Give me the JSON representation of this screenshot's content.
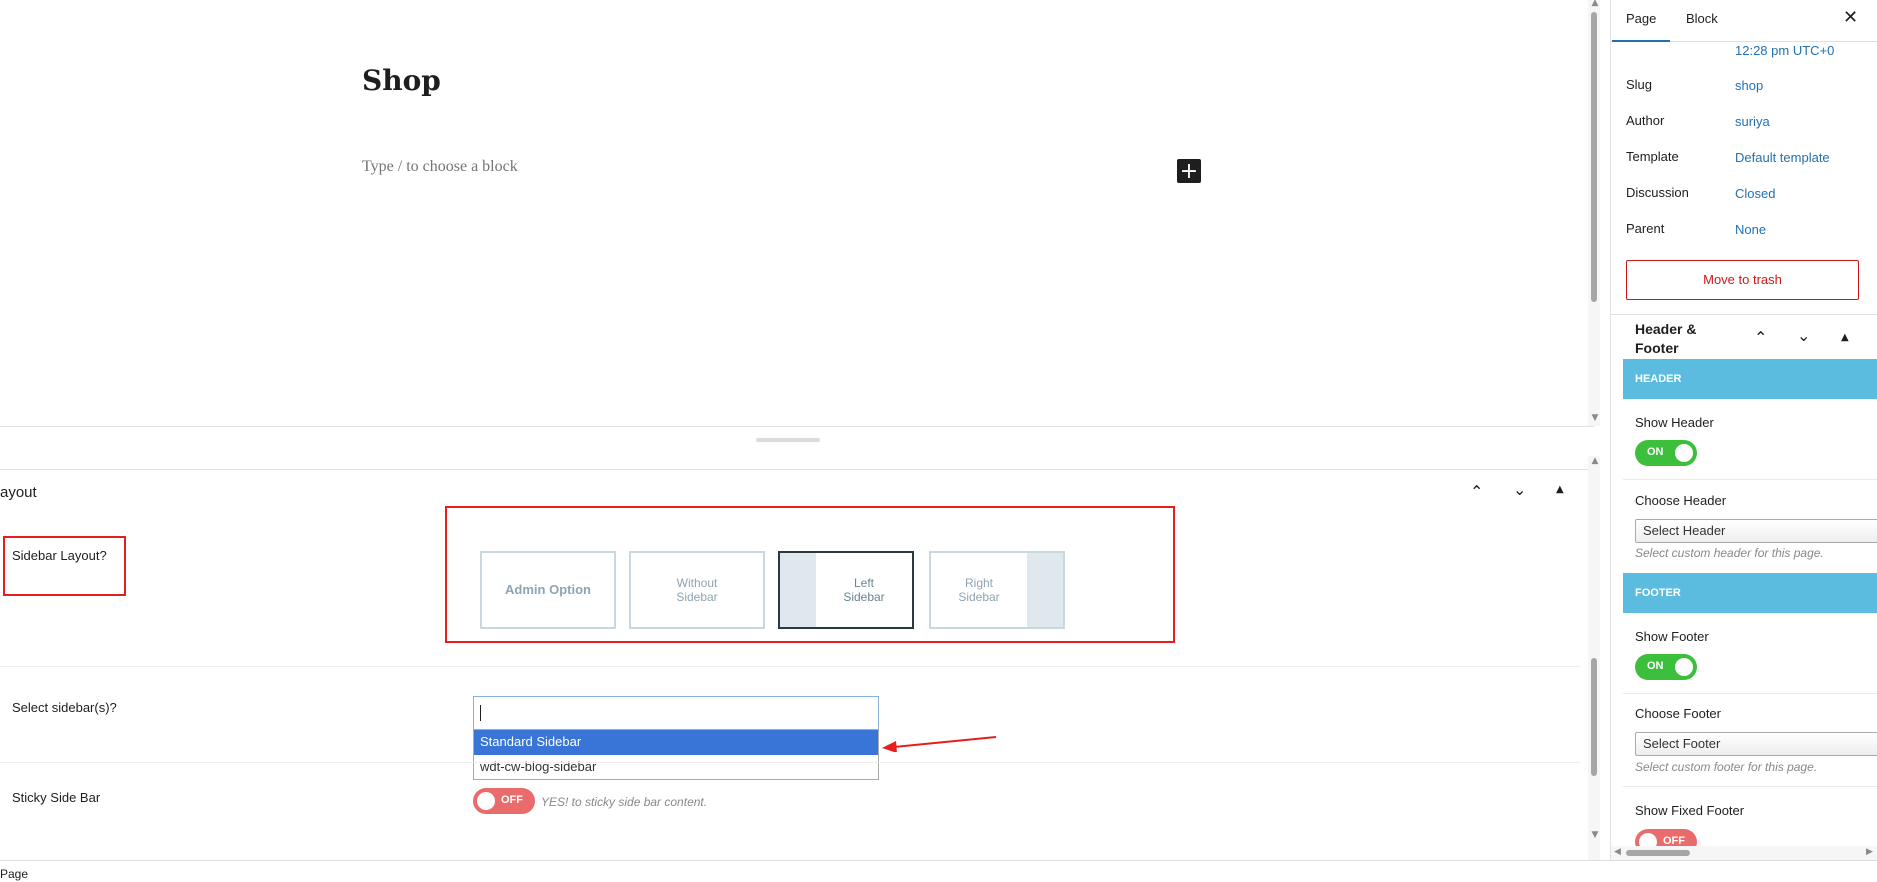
{
  "editor": {
    "title": "Shop",
    "block_placeholder": "Type / to choose a block",
    "add_block_symbol": "+"
  },
  "metabox": {
    "title": "ayout",
    "sidebar_layout_label": "Sidebar Layout?",
    "layout_options": [
      {
        "line1": "Admin Option",
        "line2": ""
      },
      {
        "line1": "Without",
        "line2": "Sidebar"
      },
      {
        "line1": "Left",
        "line2": "Sidebar"
      },
      {
        "line1": "Right",
        "line2": "Sidebar"
      }
    ],
    "selected_layout": "Left Sidebar",
    "select_sidebars_label": "Select sidebar(s)?",
    "sidebar_options": [
      "Standard Sidebar",
      "wdt-cw-blog-sidebar"
    ],
    "sticky_label": "Sticky Side Bar",
    "sticky_toggle": "OFF",
    "sticky_hint": "YES! to sticky side bar content."
  },
  "status_bar": {
    "breadcrumb": "Page"
  },
  "settings_sidebar": {
    "tabs": [
      "Page",
      "Block"
    ],
    "active_tab": "Page",
    "close_symbol": "✕",
    "publish_time": "12:28 pm UTC+0",
    "rows": [
      {
        "label": "Slug",
        "value": "shop"
      },
      {
        "label": "Author",
        "value": "suriya"
      },
      {
        "label": "Template",
        "value": "Default template"
      },
      {
        "label": "Discussion",
        "value": "Closed"
      },
      {
        "label": "Parent",
        "value": "None"
      }
    ],
    "trash_button": "Move to trash",
    "header_footer": {
      "title_line1": "Header &",
      "title_line2": "Footer",
      "header_band": "HEADER",
      "show_header_label": "Show Header",
      "show_header_toggle": "ON",
      "choose_header_label": "Choose Header",
      "choose_header_value": "Select Header",
      "choose_header_hint": "Select custom header for this page.",
      "footer_band": "FOOTER",
      "show_footer_label": "Show Footer",
      "show_footer_toggle": "ON",
      "choose_footer_label": "Choose Footer",
      "choose_footer_value": "Select Footer",
      "choose_footer_hint": "Select custom footer for this page.",
      "show_fixed_footer_label": "Show Fixed Footer",
      "show_fixed_footer_toggle": "OFF"
    }
  },
  "colors": {
    "accent_blue": "#2271b1",
    "annotation_red": "#e61e1e",
    "band_blue": "#5bbcdf",
    "toggle_on": "#3cbf3c",
    "toggle_off": "#ea6b6b",
    "trash_red": "#cc1818",
    "dropdown_highlight": "#3875d7"
  },
  "icons": {
    "add_block": "plus-icon",
    "close": "close-icon",
    "move_up": "chevron-up-icon",
    "move_down": "chevron-down-icon",
    "collapse": "triangle-up-icon",
    "annotation": "red-arrow-icon"
  }
}
